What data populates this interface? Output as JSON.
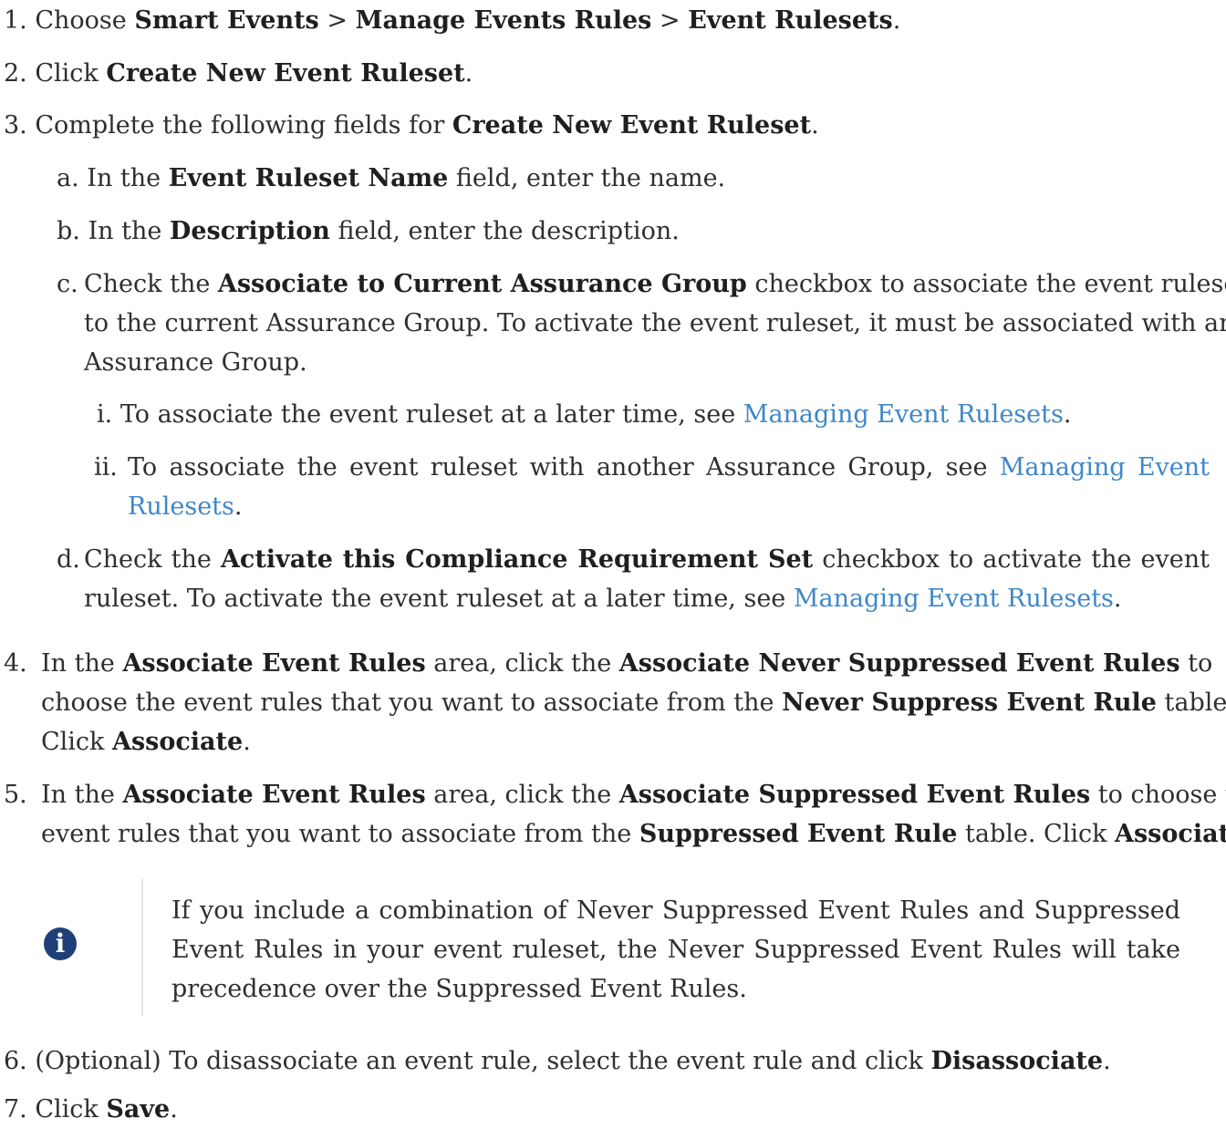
{
  "steps": [
    {
      "num": "1.",
      "text": [
        "Choose ",
        "Smart Events",
        " > ",
        "Manage Events Rules",
        " > ",
        "Event Rulesets",
        "."
      ]
    },
    {
      "num": "2.",
      "text": [
        "Click ",
        "Create New Event Ruleset",
        "."
      ]
    },
    {
      "num": "3.",
      "text": [
        "Complete the following fields for ",
        "Create New Event Ruleset",
        "."
      ],
      "substeps": [
        {
          "num": "a.",
          "text": [
            "In the ",
            "Event Ruleset Name",
            " field, enter the name."
          ]
        },
        {
          "num": "b.",
          "text": [
            "In the ",
            "Description",
            " field, enter the description."
          ]
        },
        {
          "num": "c.",
          "lines": [
            [
              "Check the ",
              "Associate to Current Assurance Group",
              " checkbox to associate the event ruleset"
            ],
            [
              "to the current Assurance Group. To activate the event ruleset, it must be associated with an"
            ],
            [
              "Assurance Group."
            ]
          ],
          "subsubsteps": [
            {
              "num": "i.",
              "text": "To associate the event ruleset at a later time, see ",
              "link": "Managing Event Rulesets",
              "end": "."
            },
            {
              "num": "ii.",
              "text": "To associate the event ruleset with another Assurance Group, see ",
              "link_a": "Managing Event",
              "link_b": "Rulesets",
              "end": "."
            }
          ]
        },
        {
          "num": "d.",
          "lines": [
            [
              "Check the ",
              "Activate this Compliance Requirement Set",
              " checkbox to activate the event"
            ],
            [
              "ruleset. To activate the event ruleset at a later time, see "
            ]
          ],
          "link": "Managing Event Rulesets",
          "end": "."
        }
      ]
    },
    {
      "num": "4.",
      "lines": [
        [
          "In the ",
          "Associate Event Rules",
          " area, click the ",
          "Associate Never Suppressed Event Rules",
          " to"
        ],
        [
          "choose the event rules that you want to associate from the ",
          "Never Suppress Event Rule",
          " table."
        ],
        [
          "Click ",
          "Associate",
          "."
        ]
      ]
    },
    {
      "num": "5.",
      "lines": [
        [
          "In the ",
          "Associate Event Rules",
          " area, click the ",
          "Associate Suppressed Event Rules",
          " to choose the"
        ],
        [
          "event rules that you want to associate from the ",
          "Suppressed Event Rule",
          " table. Click ",
          "Associate",
          "."
        ]
      ]
    },
    {
      "num": "6.",
      "text": [
        "(Optional) To disassociate an event rule, select the event rule and click ",
        "Disassociate",
        "."
      ]
    },
    {
      "num": "7.",
      "text": [
        "Click ",
        "Save",
        "."
      ]
    }
  ],
  "note": {
    "icon": "info-icon",
    "lines": [
      "If you include a combination of Never Suppressed Event Rules and Suppressed",
      "Event Rules in your event ruleset, the Never Suppressed Event Rules will take",
      "precedence over the Suppressed Event Rules."
    ]
  }
}
